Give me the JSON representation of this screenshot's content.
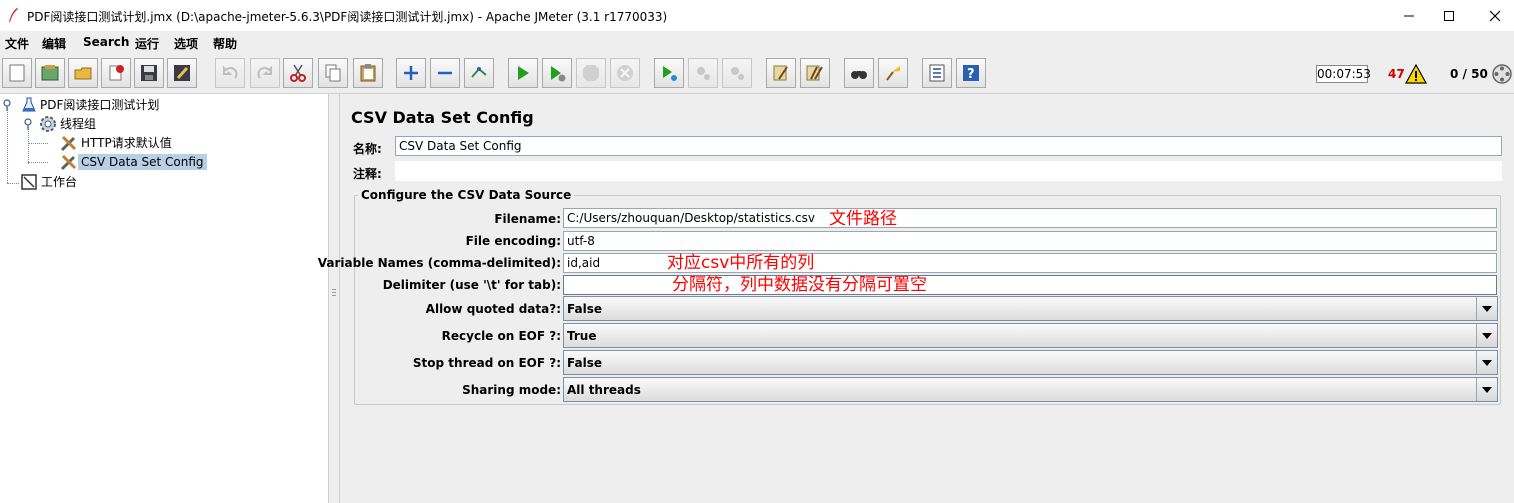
{
  "window": {
    "title": "PDF阅读接口测试计划.jmx (D:\\apache-jmeter-5.6.3\\PDF阅读接口测试计划.jmx) - Apache JMeter (3.1 r1770033)"
  },
  "menu": {
    "file": "文件",
    "edit": "编辑",
    "search": "Search",
    "run": "运行",
    "options": "选项",
    "help": "帮助"
  },
  "status": {
    "timer": "00:07:53",
    "error_count": "47",
    "threads": "0 / 50"
  },
  "tree": {
    "root": "PDF阅读接口测试计划",
    "thread_group": "线程组",
    "http_defaults": "HTTP请求默认值",
    "csv_config": "CSV Data Set Config",
    "workbench": "工作台"
  },
  "panel": {
    "title": "CSV Data Set Config",
    "name_label": "名称:",
    "name_value": "CSV Data Set Config",
    "comment_label": "注释:",
    "comment_value": "",
    "section_title": "Configure the CSV Data Source",
    "filename_label": "Filename:",
    "filename_value": "C:/Users/zhouquan/Desktop/statistics.csv",
    "encoding_label": "File encoding:",
    "encoding_value": "utf-8",
    "varnames_label": "Variable Names (comma-delimited):",
    "varnames_value": "id,aid",
    "delimiter_label": "Delimiter (use '\\t' for tab):",
    "delimiter_value": "",
    "quoted_label": "Allow quoted data?:",
    "quoted_value": "False",
    "recycle_label": "Recycle on EOF ?:",
    "recycle_value": "True",
    "stop_label": "Stop thread on EOF ?:",
    "stop_value": "False",
    "sharing_label": "Sharing mode:",
    "sharing_value": "All threads"
  },
  "annotations": {
    "filename_note": "文件路径",
    "varnames_note": "对应csv中所有的列",
    "delimiter_note": "分隔符，列中数据没有分隔可置空"
  },
  "icons": {
    "toolbar": [
      "new-icon",
      "templates-icon",
      "open-icon",
      "close-icon",
      "save-icon",
      "save-as-icon",
      "undo-icon",
      "redo-icon",
      "cut-icon",
      "copy-icon",
      "paste-icon",
      "expand-icon",
      "collapse-icon",
      "toggle-icon",
      "start-icon",
      "start-no-pause-icon",
      "stop-icon",
      "shutdown-icon",
      "remote-start-icon",
      "remote-stop-icon",
      "remote-shutdown-icon",
      "clear-icon",
      "clear-all-icon",
      "search-icon",
      "reset-search-icon",
      "function-helper-icon",
      "help-icon"
    ]
  },
  "colors": {
    "selection": "#b8cfe5",
    "error": "#d00000",
    "annotation": "#ff0000"
  }
}
